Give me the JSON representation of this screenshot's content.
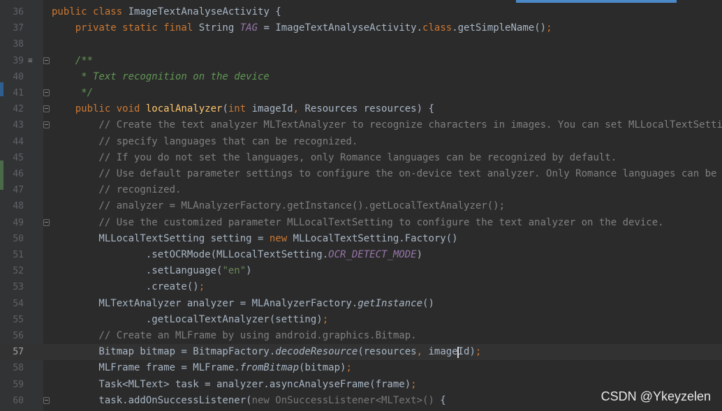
{
  "editor": {
    "current_line": "57",
    "lines": [
      {
        "num": "36",
        "t": [
          "public class ",
          "ImageTextAnalyseActivity {"
        ]
      },
      {
        "num": "37",
        "t": [
          "    private static final ",
          "String ",
          "TAG",
          " = ImageTextAnalyseActivity.",
          "class",
          ".getSimpleName()",
          ";"
        ]
      },
      {
        "num": "38",
        "t": []
      },
      {
        "num": "39",
        "t": [
          "    /**"
        ]
      },
      {
        "num": "40",
        "t": [
          "     * Text recognition on the device"
        ]
      },
      {
        "num": "41",
        "t": [
          "     */"
        ]
      },
      {
        "num": "42",
        "t": [
          "    public void ",
          "localAnalyzer",
          "(",
          "int ",
          "imageId",
          ", ",
          "Resources resources) {"
        ]
      },
      {
        "num": "43",
        "t": [
          "        // Create the text analyzer MLTextAnalyzer to recognize characters in images. You can set MLLocalTextSetting to"
        ]
      },
      {
        "num": "44",
        "t": [
          "        // specify languages that can be recognized."
        ]
      },
      {
        "num": "45",
        "t": [
          "        // If you do not set the languages, only Romance languages can be recognized by default."
        ]
      },
      {
        "num": "46",
        "t": [
          "        // Use default parameter settings to configure the on-device text analyzer. Only Romance languages can be"
        ]
      },
      {
        "num": "47",
        "t": [
          "        // recognized."
        ]
      },
      {
        "num": "48",
        "t": [
          "        // analyzer = MLAnalyzerFactory.getInstance().getLocalTextAnalyzer();"
        ]
      },
      {
        "num": "49",
        "t": [
          "        // Use the customized parameter MLLocalTextSetting to configure the text analyzer on the device."
        ]
      },
      {
        "num": "50",
        "t": [
          "        MLLocalTextSetting setting = ",
          "new ",
          "MLLocalTextSetting.Factory()"
        ]
      },
      {
        "num": "51",
        "t": [
          "                .setOCRMode(MLLocalTextSetting.",
          "OCR_DETECT_MODE",
          ")"
        ]
      },
      {
        "num": "52",
        "t": [
          "                .setLanguage(",
          "\"en\"",
          ")"
        ]
      },
      {
        "num": "53",
        "t": [
          "                .create()",
          ";"
        ]
      },
      {
        "num": "54",
        "t": [
          "        MLTextAnalyzer analyzer = MLAnalyzerFactory.",
          "getInstance",
          "()"
        ]
      },
      {
        "num": "55",
        "t": [
          "                .getLocalTextAnalyzer(setting)",
          ";"
        ]
      },
      {
        "num": "56",
        "t": [
          "        // Create an MLFrame by using android.graphics.Bitmap."
        ]
      },
      {
        "num": "57",
        "t": [
          "        Bitmap bitmap = BitmapFactory.",
          "decodeResource",
          "(resources",
          ", ",
          "imageId)",
          ";"
        ]
      },
      {
        "num": "58",
        "t": [
          "        MLFrame frame = MLFrame.",
          "fromBitmap",
          "(bitmap)",
          ";"
        ]
      },
      {
        "num": "59",
        "t": [
          "        Task<MLText> task = analyzer.asyncAnalyseFrame(frame)",
          ";"
        ]
      },
      {
        "num": "60",
        "t": [
          "        task.addOnSuccessListener(",
          "new OnSuccessListener<MLText>() ",
          "{"
        ]
      }
    ]
  },
  "watermark": "CSDN @Ykeyzelen"
}
